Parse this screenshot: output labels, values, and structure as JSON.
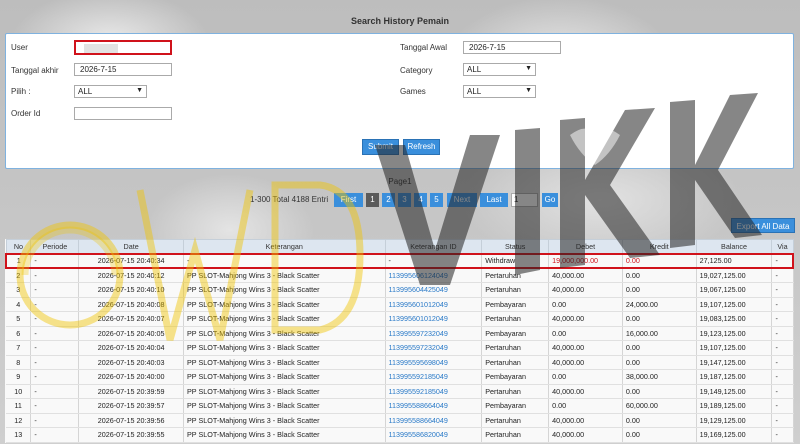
{
  "page_title": "Search History Pemain",
  "form": {
    "user_label": "User",
    "user_value": "",
    "tanggal_awal_label": "Tanggal Awal",
    "tanggal_awal_value": "2026-7-15",
    "tanggal_akhir_label": "Tanggal akhir",
    "tanggal_akhir_value": "2026-7-15",
    "category_label": "Category",
    "category_value": "ALL",
    "pilih_label": "Pilih :",
    "pilih_value": "ALL",
    "games_label": "Games",
    "games_value": "ALL",
    "order_id_label": "Order Id",
    "order_id_value": "",
    "submit_label": "Submit",
    "refresh_label": "Refresh"
  },
  "pagination": {
    "page_text": "Page1",
    "total_text": "1-300 Total 4188 Entri",
    "first": "First",
    "pages": [
      "1",
      "2",
      "3",
      "4",
      "5"
    ],
    "next": "Next",
    "last": "Last",
    "page_input": "1",
    "go": "Go"
  },
  "export_label": "Export All Data",
  "table": {
    "headers": [
      "No",
      "Periode",
      "Date",
      "Keterangan",
      "Keterangan ID",
      "Status",
      "Debet",
      "Kredit",
      "Balance",
      "Via"
    ],
    "rows": [
      {
        "no": "1",
        "periode": "-",
        "date": "2026-07-15 20:40:34",
        "ket": "-",
        "ketid": "-",
        "status": "Withdraw",
        "debet": "19,000,000.00",
        "kredit": "0.00",
        "balance": "27,125.00",
        "via": "-"
      },
      {
        "no": "2",
        "periode": "-",
        "date": "2026-07-15 20:40:12",
        "ket": "PP SLOT-Mahjong Wins 3 - Black Scatter",
        "ketid": "113995606124049",
        "status": "Pertaruhan",
        "debet": "40,000.00",
        "kredit": "0.00",
        "balance": "19,027,125.00",
        "via": "-"
      },
      {
        "no": "3",
        "periode": "-",
        "date": "2026-07-15 20:40:10",
        "ket": "PP SLOT-Mahjong Wins 3 - Black Scatter",
        "ketid": "113995604425049",
        "status": "Pertaruhan",
        "debet": "40,000.00",
        "kredit": "0.00",
        "balance": "19,067,125.00",
        "via": "-"
      },
      {
        "no": "4",
        "periode": "-",
        "date": "2026-07-15 20:40:08",
        "ket": "PP SLOT-Mahjong Wins 3 - Black Scatter",
        "ketid": "113995601012049",
        "status": "Pembayaran",
        "debet": "0.00",
        "kredit": "24,000.00",
        "balance": "19,107,125.00",
        "via": "-"
      },
      {
        "no": "5",
        "periode": "-",
        "date": "2026-07-15 20:40:07",
        "ket": "PP SLOT-Mahjong Wins 3 - Black Scatter",
        "ketid": "113995601012049",
        "status": "Pertaruhan",
        "debet": "40,000.00",
        "kredit": "0.00",
        "balance": "19,083,125.00",
        "via": "-"
      },
      {
        "no": "6",
        "periode": "-",
        "date": "2026-07-15 20:40:05",
        "ket": "PP SLOT-Mahjong Wins 3 - Black Scatter",
        "ketid": "113995597232049",
        "status": "Pembayaran",
        "debet": "0.00",
        "kredit": "16,000.00",
        "balance": "19,123,125.00",
        "via": "-"
      },
      {
        "no": "7",
        "periode": "-",
        "date": "2026-07-15 20:40:04",
        "ket": "PP SLOT-Mahjong Wins 3 - Black Scatter",
        "ketid": "113995597232049",
        "status": "Pertaruhan",
        "debet": "40,000.00",
        "kredit": "0.00",
        "balance": "19,107,125.00",
        "via": "-"
      },
      {
        "no": "8",
        "periode": "-",
        "date": "2026-07-15 20:40:03",
        "ket": "PP SLOT-Mahjong Wins 3 - Black Scatter",
        "ketid": "113995595698049",
        "status": "Pertaruhan",
        "debet": "40,000.00",
        "kredit": "0.00",
        "balance": "19,147,125.00",
        "via": "-"
      },
      {
        "no": "9",
        "periode": "-",
        "date": "2026-07-15 20:40:00",
        "ket": "PP SLOT-Mahjong Wins 3 - Black Scatter",
        "ketid": "113995592185049",
        "status": "Pembayaran",
        "debet": "0.00",
        "kredit": "38,000.00",
        "balance": "19,187,125.00",
        "via": "-"
      },
      {
        "no": "10",
        "periode": "-",
        "date": "2026-07-15 20:39:59",
        "ket": "PP SLOT-Mahjong Wins 3 - Black Scatter",
        "ketid": "113995592185049",
        "status": "Pertaruhan",
        "debet": "40,000.00",
        "kredit": "0.00",
        "balance": "19,149,125.00",
        "via": "-"
      },
      {
        "no": "11",
        "periode": "-",
        "date": "2026-07-15 20:39:57",
        "ket": "PP SLOT-Mahjong Wins 3 - Black Scatter",
        "ketid": "113995588664049",
        "status": "Pembayaran",
        "debet": "0.00",
        "kredit": "60,000.00",
        "balance": "19,189,125.00",
        "via": "-"
      },
      {
        "no": "12",
        "periode": "-",
        "date": "2026-07-15 20:39:56",
        "ket": "PP SLOT-Mahjong Wins 3 - Black Scatter",
        "ketid": "113995588664049",
        "status": "Pertaruhan",
        "debet": "40,000.00",
        "kredit": "0.00",
        "balance": "19,129,125.00",
        "via": "-"
      },
      {
        "no": "13",
        "periode": "-",
        "date": "2026-07-15 20:39:55",
        "ket": "PP SLOT-Mahjong Wins 3 - Black Scatter",
        "ketid": "113995586820049",
        "status": "Pertaruhan",
        "debet": "40,000.00",
        "kredit": "0.00",
        "balance": "19,169,125.00",
        "via": "-"
      }
    ]
  },
  "watermark_logo": "WDVIKK",
  "colors": {
    "accent": "#3a8fdc",
    "highlight": "#d0121b",
    "link": "#2a7ac8",
    "watermark": "#f0c400"
  }
}
